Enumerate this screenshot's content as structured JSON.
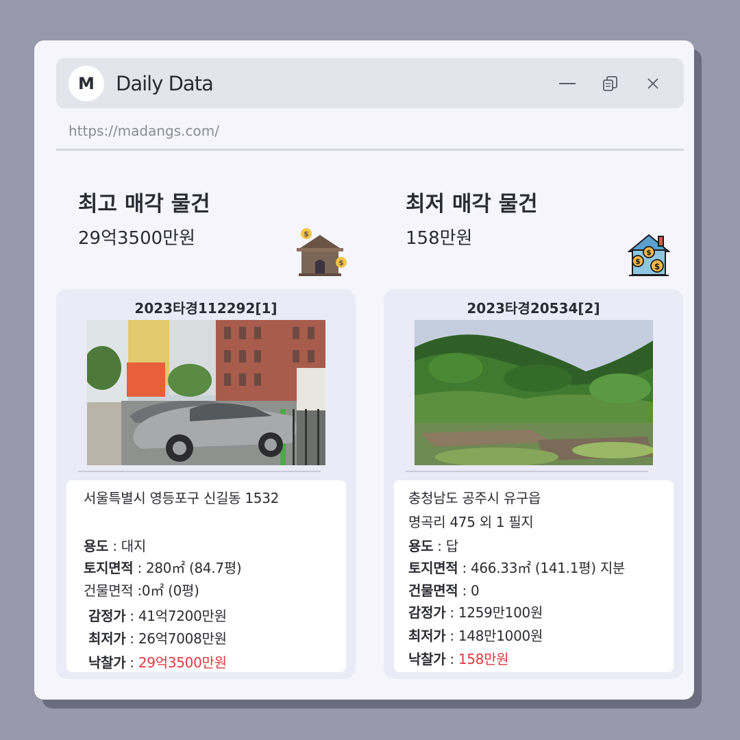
{
  "app": {
    "logo_letter": "M",
    "title": "Daily Data",
    "url": "https://madangs.com/"
  },
  "summary": {
    "highest": {
      "title": "최고 매각 물건",
      "price": "29억3500만원",
      "icon": "house-money-icon"
    },
    "lowest": {
      "title": "최저 매각 물건",
      "price": "158만원",
      "icon": "house-coins-icon"
    }
  },
  "cards": [
    {
      "case_no": "2023타경112292[1]",
      "photo": "parked-cars-street-photo",
      "address1": "서울특별시 영등포구 신길동 1532",
      "address2": "",
      "use_label": "용도",
      "use_value": " : 대지",
      "land_label": "토지면적",
      "land_value": " : 280㎡ (84.7평)",
      "bldg_label": "건물면적",
      "bldg_value": " :0㎡ (0평)",
      "appraisal_label": "감정가",
      "appraisal_value": " : 41억7200만원",
      "min_label": "최저가",
      "min_value": " : 26억7008만원",
      "sold_label": "낙찰가",
      "sold_sep": " : ",
      "sold_value": "29억3500만원"
    },
    {
      "case_no": "2023타경20534[2]",
      "photo": "forest-hill-field-photo",
      "address1": "충청남도 공주시 유구읍",
      "address2": "명곡리 475 외 1 필지",
      "use_label": "용도",
      "use_value": " : 답",
      "land_label": "토지면적",
      "land_value": " : 466.33㎡ (141.1평) 지분",
      "bldg_label": "건물면적",
      "bldg_value": " : 0",
      "appraisal_label": "감정가",
      "appraisal_value": " : 1259만100원",
      "min_label": "최저가",
      "min_value": " : 148만1000원",
      "sold_label": "낙찰가",
      "sold_sep": " : ",
      "sold_value": "158만원"
    }
  ],
  "colors": {
    "background": "#9899ab",
    "window": "#f5f5fb",
    "titlebar": "#e3e4ec",
    "card": "#ebebf7",
    "sold_price": "#e0383e"
  }
}
